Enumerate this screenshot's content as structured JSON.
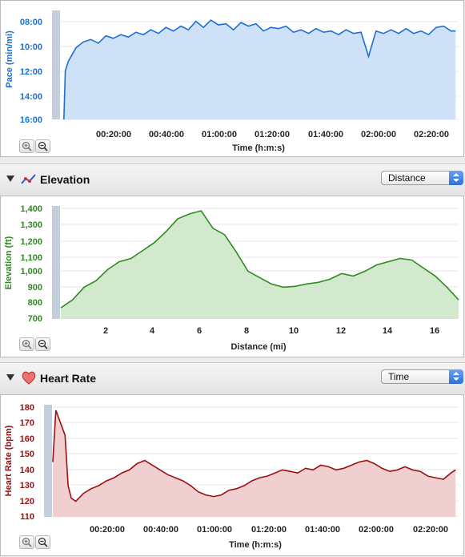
{
  "charts": {
    "pace": {
      "ylabel": "Pace (min/mi)",
      "xlabel": "Time (h:m:s)",
      "yticks": [
        "08:00",
        "10:00",
        "12:00",
        "14:00",
        "16:00"
      ],
      "xticks": [
        "00:20:00",
        "00:40:00",
        "01:00:00",
        "01:20:00",
        "01:40:00",
        "02:00:00",
        "02:20:00"
      ],
      "line_color": "#1a6fd6",
      "fill_color": "#cfe1f7"
    },
    "elevation": {
      "title": "Elevation",
      "selector": "Distance",
      "ylabel": "Elevation (ft)",
      "xlabel": "Distance (mi)",
      "yticks": [
        "1,400",
        "1,300",
        "1,200",
        "1,100",
        "1,000",
        "900",
        "800",
        "700"
      ],
      "xticks": [
        "2",
        "4",
        "6",
        "8",
        "10",
        "12",
        "14",
        "16"
      ],
      "line_color": "#2e8b1f",
      "fill_color": "#d3e9cd"
    },
    "heart_rate": {
      "title": "Heart Rate",
      "selector": "Time",
      "ylabel": "Heart Rate (bpm)",
      "xlabel": "Time (h:m:s)",
      "yticks": [
        "180",
        "170",
        "160",
        "150",
        "140",
        "130",
        "120",
        "110"
      ],
      "xticks": [
        "00:20:00",
        "00:40:00",
        "01:00:00",
        "01:20:00",
        "01:40:00",
        "02:00:00",
        "02:20:00"
      ],
      "line_color": "#9b1010",
      "fill_color": "#efcfcf"
    }
  },
  "chart_data": [
    {
      "type": "line",
      "ylabel": "Pace (min/mi)",
      "xlabel": "Time (h:m:s)",
      "y_inverted": true,
      "ylim": [
        16,
        7
      ],
      "xlim": [
        0,
        2.65
      ],
      "x": [
        0.02,
        0.03,
        0.05,
        0.1,
        0.15,
        0.2,
        0.25,
        0.3,
        0.35,
        0.4,
        0.45,
        0.5,
        0.55,
        0.6,
        0.65,
        0.7,
        0.75,
        0.8,
        0.85,
        0.9,
        0.95,
        1.0,
        1.05,
        1.1,
        1.15,
        1.2,
        1.25,
        1.3,
        1.35,
        1.4,
        1.45,
        1.5,
        1.55,
        1.6,
        1.65,
        1.7,
        1.75,
        1.8,
        1.85,
        1.9,
        1.95,
        2.0,
        2.05,
        2.1,
        2.15,
        2.2,
        2.25,
        2.3,
        2.35,
        2.4,
        2.45,
        2.5,
        2.55,
        2.6,
        2.63
      ],
      "series": [
        {
          "y": [
            16.0,
            12.0,
            11.2,
            10.1,
            9.6,
            9.4,
            9.7,
            9.1,
            9.3,
            9.0,
            9.2,
            8.8,
            9.0,
            8.6,
            8.9,
            8.4,
            8.7,
            8.3,
            8.6,
            7.9,
            8.4,
            7.8,
            8.2,
            8.1,
            8.6,
            8.0,
            8.3,
            8.1,
            8.7,
            8.4,
            8.5,
            8.3,
            8.8,
            8.6,
            8.9,
            8.5,
            8.8,
            8.7,
            9.0,
            8.6,
            8.9,
            8.8,
            10.8,
            8.7,
            8.9,
            8.6,
            8.9,
            8.5,
            8.9,
            8.7,
            9.0,
            8.4,
            8.3,
            8.7,
            8.7
          ]
        }
      ]
    },
    {
      "type": "area",
      "ylabel": "Elevation (ft)",
      "xlabel": "Distance (mi)",
      "ylim": [
        700,
        1400
      ],
      "xlim": [
        0,
        17
      ],
      "x": [
        0,
        0.5,
        1,
        1.5,
        2,
        2.5,
        3,
        3.5,
        4,
        4.5,
        5,
        5.5,
        6,
        6.5,
        7,
        7.5,
        8,
        8.5,
        9,
        9.5,
        10,
        10.5,
        11,
        11.5,
        12,
        12.5,
        13,
        13.5,
        14,
        14.5,
        15,
        15.5,
        16,
        16.5,
        17
      ],
      "series": [
        {
          "y": [
            770,
            820,
            900,
            940,
            1010,
            1060,
            1080,
            1130,
            1180,
            1250,
            1330,
            1360,
            1380,
            1270,
            1230,
            1120,
            1000,
            960,
            920,
            900,
            905,
            920,
            930,
            950,
            985,
            970,
            1000,
            1040,
            1060,
            1080,
            1070,
            1020,
            970,
            900,
            820
          ]
        }
      ]
    },
    {
      "type": "area",
      "ylabel": "Heart Rate (bpm)",
      "xlabel": "Time (h:m:s)",
      "ylim": [
        110,
        180
      ],
      "xlim": [
        0,
        2.65
      ],
      "x": [
        0,
        0.02,
        0.05,
        0.08,
        0.1,
        0.12,
        0.15,
        0.2,
        0.25,
        0.3,
        0.35,
        0.4,
        0.45,
        0.5,
        0.55,
        0.6,
        0.65,
        0.7,
        0.75,
        0.8,
        0.85,
        0.9,
        0.95,
        1.0,
        1.05,
        1.1,
        1.15,
        1.2,
        1.25,
        1.3,
        1.35,
        1.4,
        1.45,
        1.5,
        1.55,
        1.6,
        1.65,
        1.7,
        1.75,
        1.8,
        1.85,
        1.9,
        1.95,
        2.0,
        2.05,
        2.1,
        2.15,
        2.2,
        2.25,
        2.3,
        2.35,
        2.4,
        2.45,
        2.5,
        2.55,
        2.6,
        2.63
      ],
      "series": [
        {
          "y": [
            145,
            178,
            170,
            162,
            130,
            122,
            120,
            125,
            128,
            130,
            133,
            135,
            138,
            140,
            144,
            146,
            143,
            140,
            137,
            135,
            133,
            130,
            126,
            124,
            123,
            124,
            127,
            128,
            130,
            133,
            135,
            136,
            138,
            140,
            139,
            138,
            141,
            140,
            143,
            142,
            140,
            141,
            143,
            145,
            146,
            144,
            141,
            139,
            140,
            142,
            140,
            139,
            136,
            135,
            134,
            138,
            140
          ]
        }
      ]
    }
  ]
}
